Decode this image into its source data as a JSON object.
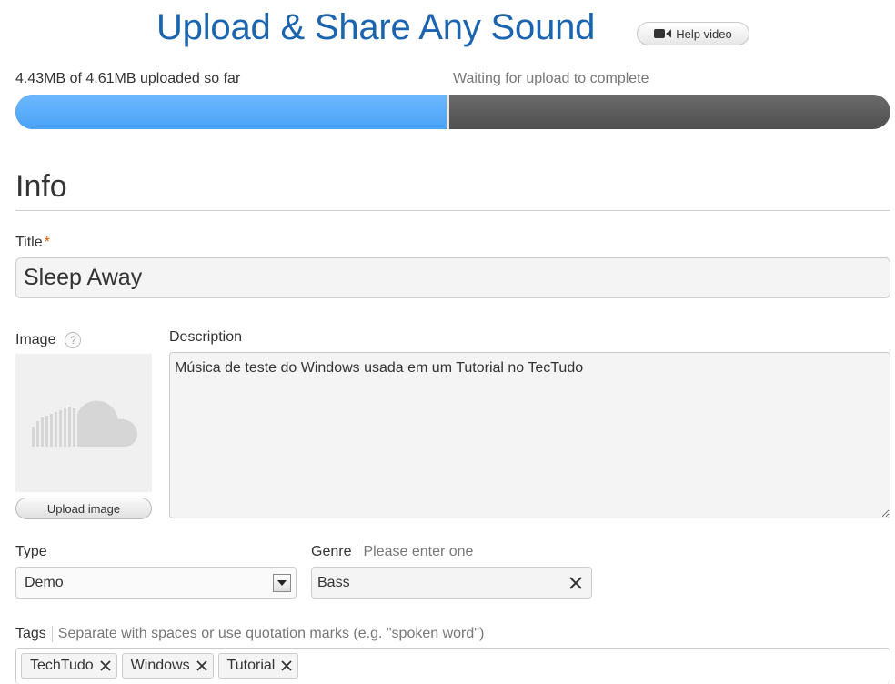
{
  "header": {
    "title": "Upload & Share Any Sound",
    "help_label": "Help video",
    "help_icon": "video-camera-icon"
  },
  "upload": {
    "status_text": "4.43MB of 4.61MB uploaded so far",
    "waiting_text": "Waiting for upload to complete",
    "progress_fraction": 0.4932,
    "marker_fraction": 0.4948,
    "fill_color": "#4aa3f5",
    "track_color": "#5c5c5c"
  },
  "info": {
    "heading": "Info",
    "title_label": "Title",
    "required_mark": "*",
    "title_value": "Sleep Away",
    "image_label": "Image",
    "image_help": "?",
    "upload_image_label": "Upload image",
    "description_label": "Description",
    "description_value": "Música de teste do Windows usada em um Tutorial no TecTudo",
    "type_label": "Type",
    "type_value": "Demo",
    "genre_label": "Genre",
    "genre_hint": "Please enter one",
    "genre_value": "Bass",
    "tags_label": "Tags",
    "tags_hint": "Separate with spaces or use quotation marks (e.g. \"spoken word\")",
    "tags": [
      "TechTudo",
      "Windows",
      "Tutorial"
    ]
  },
  "colors": {
    "title_blue": "#1a64b0",
    "required_orange": "#e05a00"
  }
}
